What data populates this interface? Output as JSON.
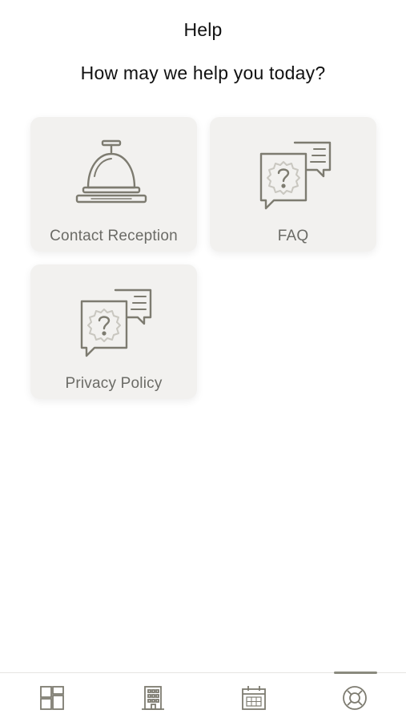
{
  "header": {
    "title": "Help",
    "subtitle": "How may we help you today?"
  },
  "cards": [
    {
      "label": "Contact Reception",
      "icon": "reception-bell-icon"
    },
    {
      "label": "FAQ",
      "icon": "faq-chat-icon"
    },
    {
      "label": "Privacy Policy",
      "icon": "privacy-chat-icon"
    }
  ],
  "bottom_nav": {
    "items": [
      {
        "icon": "dashboard-icon",
        "active": false
      },
      {
        "icon": "hotel-building-icon",
        "active": false
      },
      {
        "icon": "calendar-icon",
        "active": false
      },
      {
        "icon": "lifebuoy-help-icon",
        "active": true
      }
    ]
  },
  "colors": {
    "card_background": "#f2f1ef",
    "icon_stroke": "#7d7b70",
    "label_text": "#6b6b66",
    "active_indicator": "#8a8a7e"
  }
}
